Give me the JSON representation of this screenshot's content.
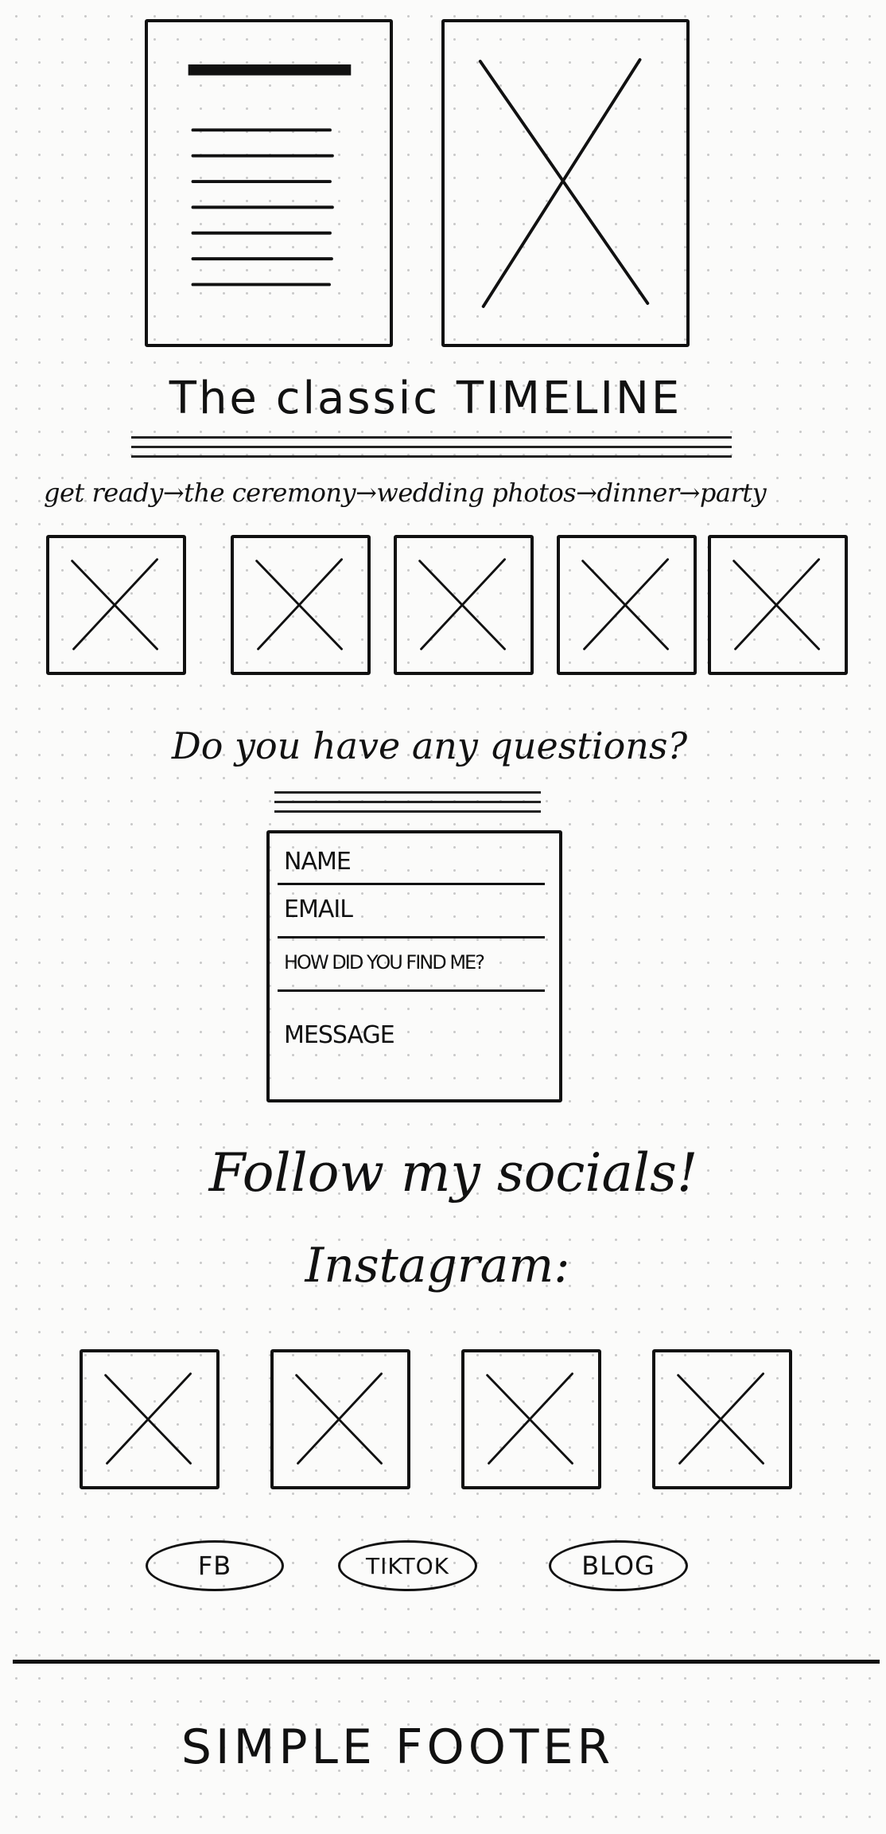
{
  "timeline": {
    "title": "The classic TIMELINE",
    "steps": "get ready→the ceremony→wedding photos→dinner→party"
  },
  "questions": {
    "heading": "Do you have any questions?",
    "form": {
      "name": "NAME",
      "email": "EMAIL",
      "how_found": "HOW DID YOU FIND ME?",
      "message": "MESSAGE"
    }
  },
  "socials": {
    "heading": "Follow my socials!",
    "instagram_label": "Instagram:",
    "buttons": {
      "fb": "FB",
      "tiktok": "TIKTOK",
      "blog": "BLOG"
    }
  },
  "footer": {
    "text": "SIMPLE FOOTER"
  },
  "icons": {
    "placeholder": "image-placeholder-icon",
    "text_block": "text-lines-icon"
  },
  "colors": {
    "ink": "#111111",
    "paper": "#fbfbfa",
    "dot": "#c9c9c9"
  }
}
